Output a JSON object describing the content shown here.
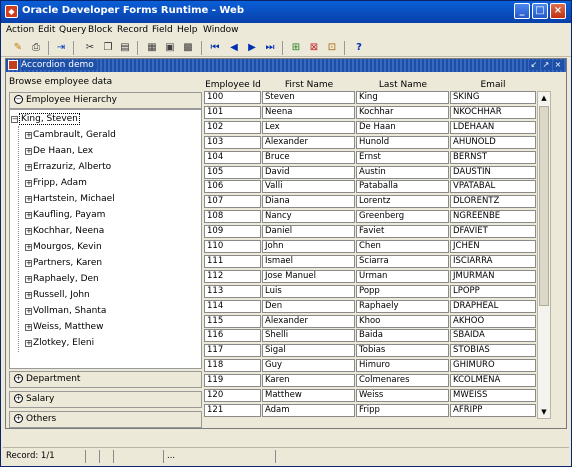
{
  "window": {
    "title": "Oracle Developer Forms Runtime - Web",
    "controls": [
      "_",
      "□",
      "×"
    ]
  },
  "menubar": {
    "items": [
      "Action",
      "Edit",
      "Query",
      "Block",
      "Record",
      "Field",
      "Help",
      "Window"
    ]
  },
  "toolbar": {
    "icons": [
      "save-icon",
      "print-icon",
      "exit-icon",
      "cut-icon",
      "copy-icon",
      "paste-icon",
      "enter-query-icon",
      "execute-query-icon",
      "cancel-query-icon",
      "first-record-icon",
      "previous-record-icon",
      "next-record-icon",
      "last-record-icon",
      "insert-record-icon",
      "delete-record-icon",
      "lock-record-icon",
      "help-icon"
    ]
  },
  "inner_window": {
    "title": "Accordion demo",
    "controls": [
      "↙",
      "↗",
      "×"
    ]
  },
  "browse_label": "Browse employee data",
  "accordion": {
    "open_section": "Employee Hierarchy",
    "closed_sections": [
      "Department",
      "Salary",
      "Others"
    ]
  },
  "tree": {
    "root": "King, Steven",
    "children": [
      "Cambrault, Gerald",
      "De Haan, Lex",
      "Errazuriz, Alberto",
      "Fripp, Adam",
      "Hartstein, Michael",
      "Kaufling, Payam",
      "Kochhar, Neena",
      "Mourgos, Kevin",
      "Partners, Karen",
      "Raphaely, Den",
      "Russell, John",
      "Vollman, Shanta",
      "Weiss, Matthew",
      "Zlotkey, Eleni"
    ]
  },
  "grid": {
    "columns": [
      "Employee Id",
      "First Name",
      "Last Name",
      "Email"
    ],
    "rows": [
      [
        "100",
        "Steven",
        "King",
        "SKING"
      ],
      [
        "101",
        "Neena",
        "Kochhar",
        "NKOCHHAR"
      ],
      [
        "102",
        "Lex",
        "De Haan",
        "LDEHAAN"
      ],
      [
        "103",
        "Alexander",
        "Hunold",
        "AHUNOLD"
      ],
      [
        "104",
        "Bruce",
        "Ernst",
        "BERNST"
      ],
      [
        "105",
        "David",
        "Austin",
        "DAUSTIN"
      ],
      [
        "106",
        "Valli",
        "Pataballa",
        "VPATABAL"
      ],
      [
        "107",
        "Diana",
        "Lorentz",
        "DLORENTZ"
      ],
      [
        "108",
        "Nancy",
        "Greenberg",
        "NGREENBE"
      ],
      [
        "109",
        "Daniel",
        "Faviet",
        "DFAVIET"
      ],
      [
        "110",
        "John",
        "Chen",
        "JCHEN"
      ],
      [
        "111",
        "Ismael",
        "Sciarra",
        "ISCIARRA"
      ],
      [
        "112",
        "Jose Manuel",
        "Urman",
        "JMURMAN"
      ],
      [
        "113",
        "Luis",
        "Popp",
        "LPOPP"
      ],
      [
        "114",
        "Den",
        "Raphaely",
        "DRAPHEAL"
      ],
      [
        "115",
        "Alexander",
        "Khoo",
        "AKHOO"
      ],
      [
        "116",
        "Shelli",
        "Baida",
        "SBAIDA"
      ],
      [
        "117",
        "Sigal",
        "Tobias",
        "STOBIAS"
      ],
      [
        "118",
        "Guy",
        "Himuro",
        "GHIMURO"
      ],
      [
        "119",
        "Karen",
        "Colmenares",
        "KCOLMENA"
      ],
      [
        "120",
        "Matthew",
        "Weiss",
        "MWEISS"
      ],
      [
        "121",
        "Adam",
        "Fripp",
        "AFRIPP"
      ]
    ]
  },
  "statusbar": {
    "record": "Record: 1/1",
    "ellipsis": "..."
  }
}
